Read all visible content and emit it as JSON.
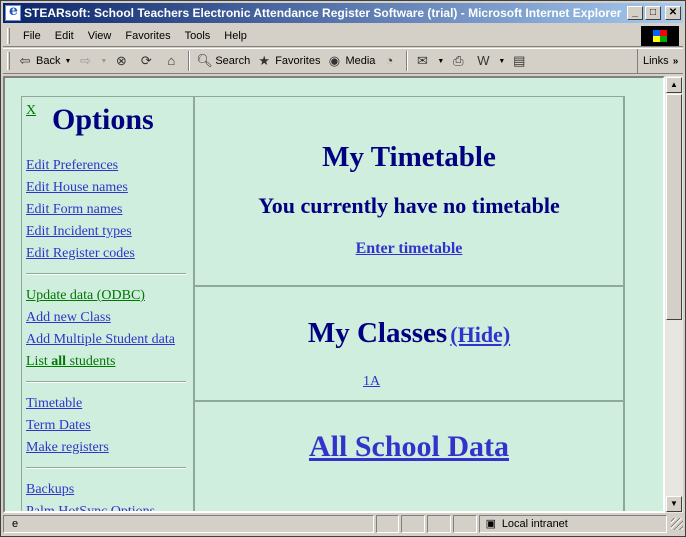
{
  "window": {
    "title": "STEARsoft: School Teachers Electronic Attendance Register Software (trial) - Microsoft Internet Explorer",
    "minimize_icon": "_",
    "maximize_icon": "□",
    "close_icon": "✕"
  },
  "menu": {
    "items": [
      "File",
      "Edit",
      "View",
      "Favorites",
      "Tools",
      "Help"
    ]
  },
  "toolbar": {
    "back_label": "Back",
    "search_label": "Search",
    "favorites_label": "Favorites",
    "media_label": "Media",
    "links_label": "Links"
  },
  "sidebar": {
    "close_label": "X",
    "title": "Options",
    "group1": [
      "Edit Preferences",
      "Edit House names",
      "Edit Form names",
      "Edit Incident types",
      "Edit Register codes"
    ],
    "group2": {
      "update": "Update data (ODBC)",
      "add_class": "Add new Class",
      "add_multiple": "Add Multiple Student data",
      "list_prefix": "List ",
      "list_bold": "all",
      "list_suffix": " students"
    },
    "group3": [
      "Timetable",
      "Term Dates",
      "Make registers"
    ],
    "group4": [
      "Backups",
      "Palm HotSync Options"
    ]
  },
  "main": {
    "timetable": {
      "title": "My Timetable",
      "message": "You currently have no timetable",
      "enter_link": "Enter timetable"
    },
    "classes": {
      "title": "My Classes",
      "hide_link": "(Hide)",
      "items": [
        "1A"
      ]
    },
    "school": {
      "link": "All School Data"
    }
  },
  "status": {
    "zone": "Local intranet"
  },
  "colors": {
    "page_bg": "#cfeedd",
    "heading": "#000080",
    "link": "#3333cc",
    "visited_link": "#007700"
  }
}
